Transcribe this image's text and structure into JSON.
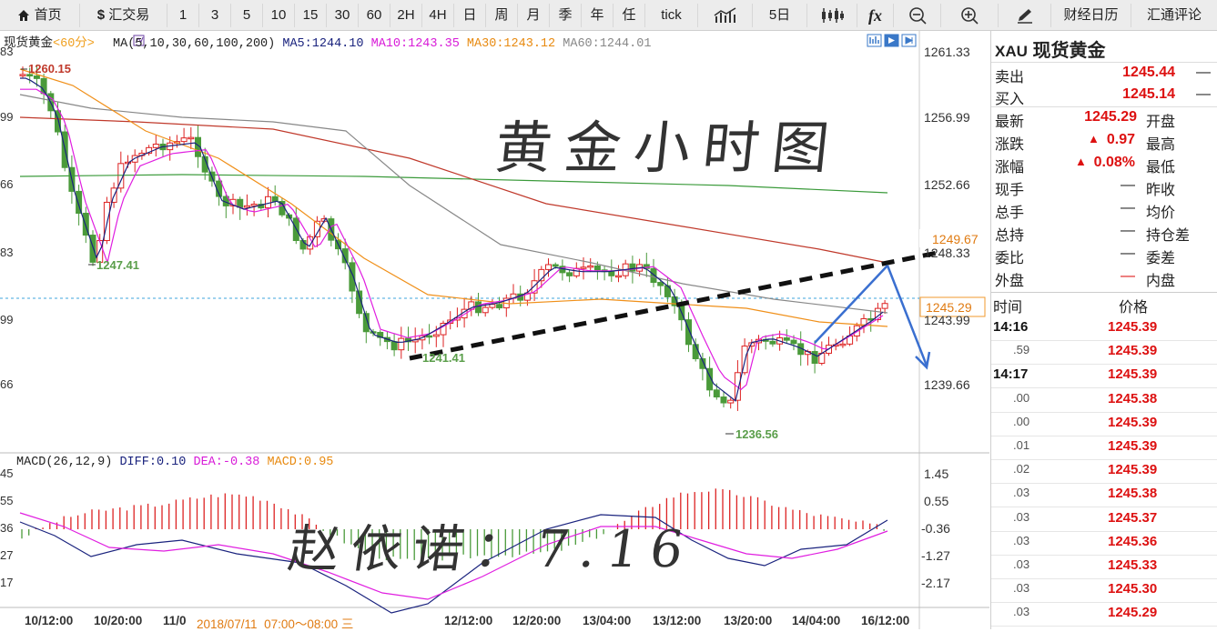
{
  "toolbar": {
    "home": "首页",
    "forex": "汇交易",
    "periods": [
      "1",
      "3",
      "5",
      "10",
      "15",
      "30",
      "60",
      "2H",
      "4H",
      "日",
      "周",
      "月",
      "季",
      "年",
      "任",
      "tick"
    ],
    "day5": "5日",
    "fx": "fx",
    "calendar": "财经日历",
    "commentary": "汇通评论"
  },
  "chart_header": {
    "symbol": "现货黄金",
    "period": "<60分>",
    "ma_label": "MA(5,10,30,60,100,200)",
    "ma5": "MA5:1244.10",
    "ma10": "MA10:1243.35",
    "ma30": "MA30:1243.12",
    "ma60": "MA60:1244.01"
  },
  "overlay_text": {
    "title": "黄金小时图",
    "signature": "赵依诺：7.16"
  },
  "price_axis": {
    "labels": [
      "1261.33",
      "1256.99",
      "1252.66",
      "1248.33",
      "1243.99",
      "1239.66"
    ],
    "left_cut_labels": [
      "83",
      "99",
      "66",
      "83",
      "99",
      "66"
    ],
    "tag_top": "1249.67",
    "tag_current": "1245.29"
  },
  "annotations": {
    "high": "1260.15",
    "low1": "1247.41",
    "low2": "1241.41",
    "low3": "1236.56"
  },
  "macd": {
    "header_label": "MACD(26,12,9)",
    "diff": "DIFF:0.10",
    "dea": "DEA:-0.38",
    "macd_val": "MACD:0.95",
    "axis": [
      "1.45",
      "0.55",
      "-0.36",
      "-1.27",
      "-2.17"
    ],
    "left_cut": [
      "45",
      "55",
      "36",
      "27",
      "17"
    ]
  },
  "time_axis": {
    "labels": [
      "10/12:00",
      "10/20:00",
      "11/0",
      "12/12:00",
      "12/20:00",
      "13/04:00",
      "13/12:00",
      "13/20:00",
      "14/04:00",
      "16/12:00"
    ],
    "cursor": "2018/07/11  07:00～08:00 三"
  },
  "quote": {
    "symbol": "XAU",
    "name": "现货黄金",
    "sell_label": "卖出",
    "sell": "1245.44",
    "buy_label": "买入",
    "buy": "1245.14",
    "last_label": "最新",
    "last": "1245.29",
    "open_label": "开盘",
    "change_label": "涨跌",
    "change": "0.97",
    "high_label": "最高",
    "pct_label": "涨幅",
    "pct": "0.08%",
    "low_label": "最低",
    "hand_label": "现手",
    "prev_close_label": "昨收",
    "total_label": "总手",
    "avg_label": "均价",
    "hold_label": "总持",
    "hold_diff_label": "持仓差",
    "ratio_label": "委比",
    "ratio_diff_label": "委差",
    "outer_label": "外盘",
    "inner_label": "内盘",
    "dash": "—",
    "time_header": "时间",
    "price_header": "价格"
  },
  "ticks": [
    {
      "time": "14:16",
      "price": "1245.39"
    },
    {
      "time": ".59",
      "price": "1245.39"
    },
    {
      "time": "14:17",
      "price": "1245.39"
    },
    {
      "time": ".00",
      "price": "1245.38"
    },
    {
      "time": ".00",
      "price": "1245.39"
    },
    {
      "time": ".01",
      "price": "1245.39"
    },
    {
      "time": ".02",
      "price": "1245.39"
    },
    {
      "time": ".03",
      "price": "1245.38"
    },
    {
      "time": ".03",
      "price": "1245.37"
    },
    {
      "time": ".03",
      "price": "1245.36"
    },
    {
      "time": ".03",
      "price": "1245.33"
    },
    {
      "time": ".03",
      "price": "1245.30"
    },
    {
      "time": ".03",
      "price": "1245.29"
    }
  ],
  "colors": {
    "up": "#d22",
    "down": "#4a9a3a",
    "ma5": "#1a237e",
    "ma10": "#e01ee0",
    "ma30": "#f0901a",
    "ma60": "#888888",
    "ma100": "#c0392b",
    "ma200": "#3a9a3a"
  }
}
